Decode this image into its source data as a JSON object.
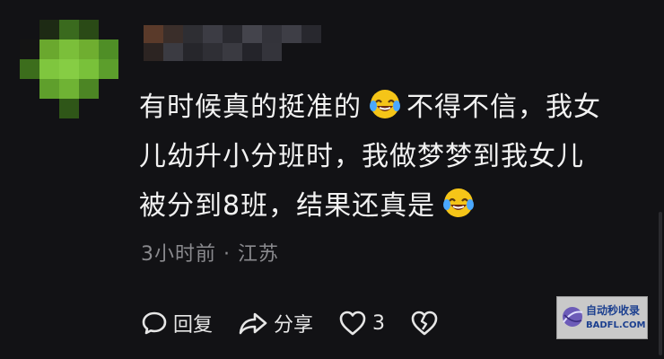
{
  "comment": {
    "lines": [
      "有时候真的挺准的",
      "不得不信，我女",
      "儿幼升小分班时，我做梦梦到我女儿",
      "被分到8班，结果还真是"
    ],
    "emoji_icon": "laughing-crying-emoji"
  },
  "meta": {
    "time": "3小时前",
    "separator": "·",
    "location": "江苏"
  },
  "actions": {
    "reply_label": "回复",
    "share_label": "分享",
    "like_count": "3"
  },
  "watermark": {
    "text_cn": "自动秒收录",
    "text_en": "BADFL.COM"
  },
  "colors": {
    "background": "#121215",
    "text": "#f2f2f2",
    "meta": "#8a8a8e",
    "emoji": "#f5c518"
  }
}
